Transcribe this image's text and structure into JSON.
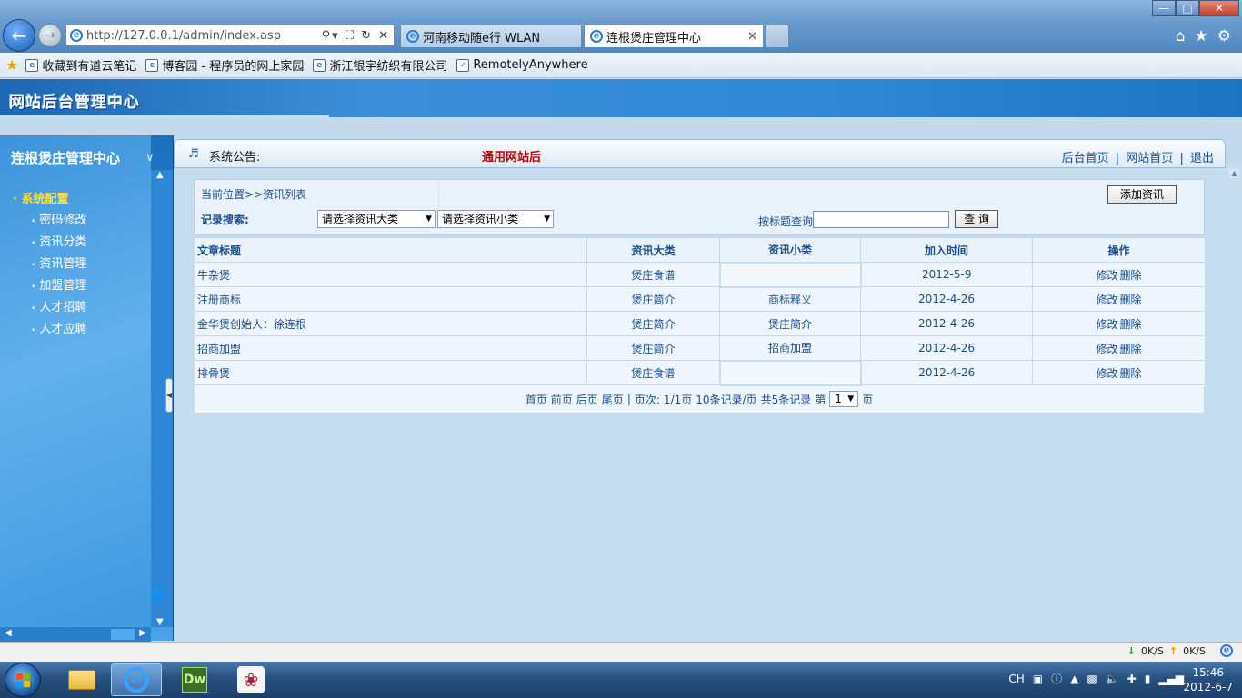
{
  "browser": {
    "url": "http://127.0.0.1/admin/index.asp",
    "tabs": [
      {
        "label": "河南移动随e行 WLAN"
      },
      {
        "label": "连根煲庄管理中心"
      }
    ],
    "favorites": [
      {
        "label": "收藏到有道云笔记"
      },
      {
        "label": "博客园 - 程序员的网上家园"
      },
      {
        "label": "浙江银宇纺织有限公司"
      },
      {
        "label": "RemotelyAnywhere"
      }
    ]
  },
  "site": {
    "header_title": "网站后台管理中心",
    "sidebar_title": "连根煲庄管理中心",
    "menu_group": "系统配置",
    "menu_items": [
      "密码修改",
      "资讯分类",
      "资讯管理",
      "加盟管理",
      "人才招聘",
      "人才应聘"
    ]
  },
  "notice": {
    "label": "系统公告:",
    "marquee": "通用网站后"
  },
  "top_links": [
    "后台首页",
    "网站首页",
    "退出"
  ],
  "toolbar": {
    "breadcrumb": "当前位置>>资讯列表",
    "add_button": "添加资讯",
    "search_label": "记录搜索:",
    "major_select": "请选择资讯大类",
    "minor_select": "请选择资讯小类",
    "title_query_label": "按标题查询",
    "title_query_value": "",
    "query_button": "查 询"
  },
  "table": {
    "headers": [
      "文章标题",
      "资讯大类",
      "资讯小类",
      "加入时间",
      "操作"
    ],
    "rows": [
      {
        "title": "牛杂煲",
        "major": "煲庄食谱",
        "minor": "",
        "date": "2012-5-9",
        "edit": "修改",
        "delete": "删除"
      },
      {
        "title": "注册商标",
        "major": "煲庄简介",
        "minor": "商标释义",
        "date": "2012-4-26",
        "edit": "修改",
        "delete": "删除"
      },
      {
        "title": "金华煲创始人：徐连根",
        "major": "煲庄简介",
        "minor": "煲庄简介",
        "date": "2012-4-26",
        "edit": "修改",
        "delete": "删除"
      },
      {
        "title": "招商加盟",
        "major": "煲庄简介",
        "minor": "招商加盟",
        "date": "2012-4-26",
        "edit": "修改",
        "delete": "删除"
      },
      {
        "title": "排骨煲",
        "major": "煲庄食谱",
        "minor": "",
        "date": "2012-4-26",
        "edit": "修改",
        "delete": "删除"
      }
    ]
  },
  "pager": {
    "first": "首页",
    "prev": "前页",
    "next": "后页",
    "last": "尾页",
    "sep": "|",
    "page_label": "页次:",
    "page_info": "1/1页",
    "per_page": "10条记录/页",
    "total": "共5条记录",
    "goto_prefix": "第",
    "current_page": "1",
    "goto_suffix": "页"
  },
  "status": {
    "down_speed": "0K/S",
    "up_speed": "0K/S"
  },
  "taskbar": {
    "dw_label": "Dw",
    "lang": "CH",
    "time": "15:46",
    "date": "2012-6-7"
  }
}
